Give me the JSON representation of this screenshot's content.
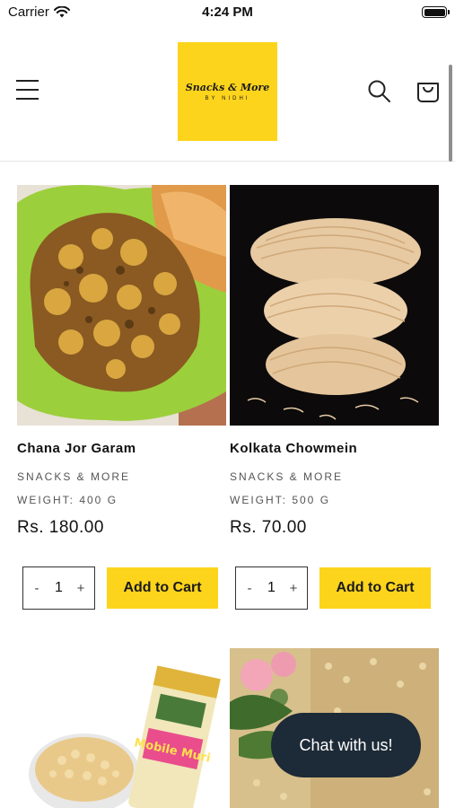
{
  "status_bar": {
    "carrier": "Carrier",
    "time": "4:24 PM"
  },
  "header": {
    "logo_main": "Snacks & More",
    "logo_sub": "BY NIDHI"
  },
  "products": [
    {
      "title": "Chana Jor Garam",
      "vendor": "SNACKS & MORE",
      "weight": "WEIGHT: 400 G",
      "price": "Rs. 180.00",
      "qty": "1",
      "minus": "-",
      "plus": "+",
      "add_to_cart": "Add to Cart"
    },
    {
      "title": "Kolkata Chowmein",
      "vendor": "SNACKS & MORE",
      "weight": "WEIGHT: 500 G",
      "price": "Rs. 70.00",
      "qty": "1",
      "minus": "-",
      "plus": "+",
      "add_to_cart": "Add to Cart"
    },
    {
      "image_label": "Mobile Muri"
    },
    {
      "image_label": ""
    }
  ],
  "chat": {
    "label": "Chat with us!"
  },
  "colors": {
    "brand_yellow": "#fdd41c",
    "chat_bg": "#1d2a37"
  }
}
